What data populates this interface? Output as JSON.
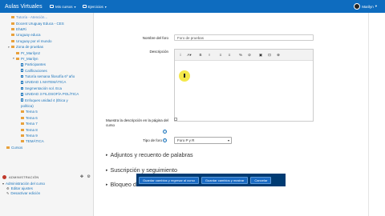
{
  "topbar": {
    "brand": "Aulas Virtuales",
    "menu1": "Mis cursos",
    "menu2": "Ejercicios",
    "user": "Marilyn"
  },
  "sidebar": {
    "tree": [
      {
        "label": "Tutoría - Atención...",
        "icon": "folder",
        "level": 1,
        "arrow": "",
        "dim": true
      },
      {
        "label": "Docent Uruguay Educa - CES",
        "icon": "folder",
        "level": 1,
        "arrow": ""
      },
      {
        "label": "Eh&Ri",
        "icon": "folder",
        "level": 1,
        "arrow": ""
      },
      {
        "label": "Uruguay educa",
        "icon": "folder",
        "level": 1,
        "arrow": ""
      },
      {
        "label": "Uruguay por el mundo",
        "icon": "folder",
        "level": 1,
        "arrow": ""
      },
      {
        "label": "Zona de pruebas",
        "icon": "folder",
        "level": 1,
        "arrow": "▾"
      },
      {
        "label": "Pr_Marilyn2",
        "icon": "folder",
        "level": 2,
        "arrow": ""
      },
      {
        "label": "Pr_Marilyn",
        "icon": "folder",
        "level": 2,
        "arrow": "▾"
      },
      {
        "label": "Participantes",
        "icon": "doc",
        "level": 3,
        "arrow": ""
      },
      {
        "label": "Calificaciones",
        "icon": "doc",
        "level": 3,
        "arrow": ""
      },
      {
        "label": "Tutoría semana filosofía 6º año",
        "icon": "doc",
        "level": 3,
        "arrow": ""
      },
      {
        "label": "UNIDAD 1 MATEMÁTICA",
        "icon": "doc",
        "level": 3,
        "arrow": ""
      },
      {
        "label": "Segmentación sol. Eca",
        "icon": "doc",
        "level": 3,
        "arrow": ""
      },
      {
        "label": "UNIDAD 3 FILOSOFÍA POLÍTICA",
        "icon": "doc",
        "level": 3,
        "arrow": ""
      },
      {
        "label": "Enfoques unidad 4 (Ética y",
        "icon": "doc",
        "level": 3,
        "arrow": ""
      },
      {
        "label": "política)",
        "icon": "",
        "level": 3,
        "arrow": ""
      },
      {
        "label": "Tema 5",
        "icon": "folder",
        "level": 3,
        "arrow": ""
      },
      {
        "label": "Tema 6",
        "icon": "folder",
        "level": 3,
        "arrow": ""
      },
      {
        "label": "Tema 7",
        "icon": "folder",
        "level": 3,
        "arrow": ""
      },
      {
        "label": "Tema 8",
        "icon": "folder",
        "level": 3,
        "arrow": ""
      },
      {
        "label": "Tema 9",
        "icon": "folder",
        "level": 3,
        "arrow": ""
      },
      {
        "label": "TEMÁTICA",
        "icon": "folder",
        "level": 3,
        "arrow": ""
      },
      {
        "label": "Cursos",
        "icon": "folder",
        "level": 0,
        "arrow": ""
      }
    ],
    "admin": {
      "title": "ADMINISTRACIÓN",
      "course_admin": "Administración del curso",
      "edit": "Editar ajustes",
      "desactivar": "Desactivar edición"
    }
  },
  "form": {
    "name_label": "Nombre del foro",
    "name_value": "Foro de pruebas",
    "desc_label": "Descripción",
    "show_desc_label": "Muestra la descripción en la página del curso",
    "type_label": "Tipo de foro",
    "type_value": "Foro P y R"
  },
  "editor": {
    "toolbar": [
      "i",
      "A▾",
      "B",
      "I",
      "≡",
      "≡",
      "%",
      "⊘",
      "▣",
      "⊡",
      "⊕"
    ]
  },
  "sections": {
    "s1": "Adjuntos y recuento de palabras",
    "s2": "Suscripción y seguimiento",
    "s3": "Bloqueo de"
  },
  "actions": {
    "save_return": "Guardar cambios y regresar al curso",
    "save_show": "Guardar cambios y mostrar",
    "cancel": "Cancelar"
  },
  "colors": {
    "topbar": "#0e6cbf",
    "link": "#1c75bc",
    "actionbar": "#003b73"
  }
}
